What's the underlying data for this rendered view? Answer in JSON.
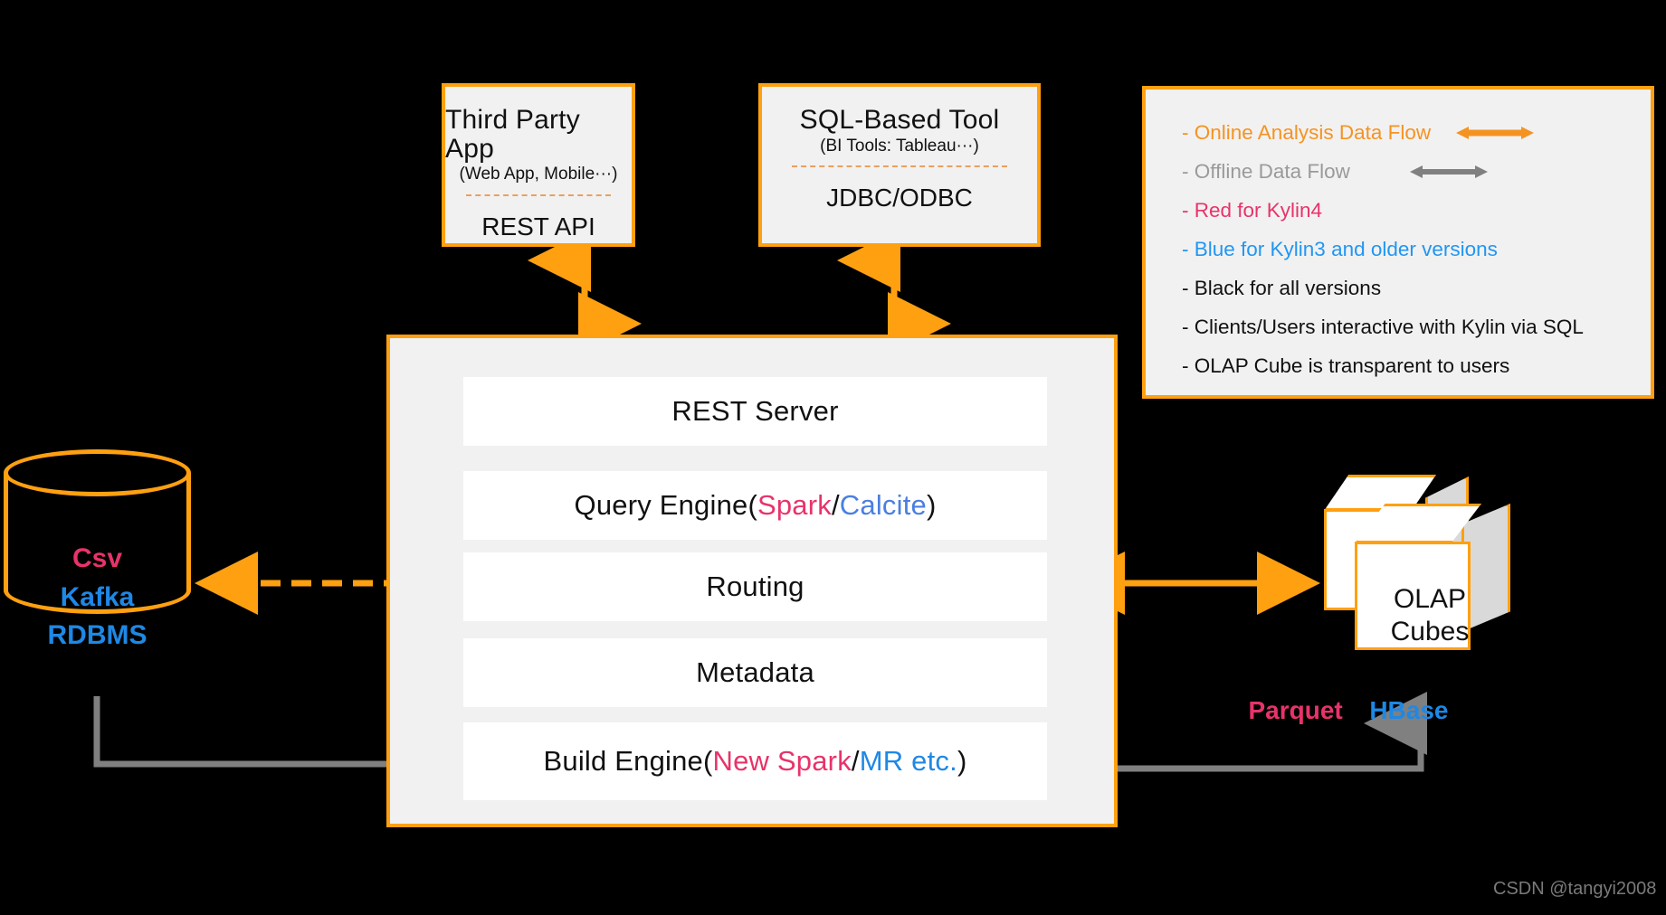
{
  "colors": {
    "orange": "#FFA010",
    "legend_orange": "#F59322",
    "gray": "#808080",
    "pink": "#E8336A",
    "blue": "#4A7FE0",
    "blue_bright": "#1E88E5",
    "box_fill": "#f1f1f1",
    "layer_fill": "#ffffff",
    "background": "#000000"
  },
  "clients": [
    {
      "id": "third-party-app",
      "title": "Third Party App",
      "subtitle": "(Web App, Mobile···)",
      "protocol": "REST API"
    },
    {
      "id": "sql-based-tool",
      "title": "SQL-Based Tool",
      "subtitle": "(BI Tools: Tableau···)",
      "protocol": "JDBC/ODBC"
    }
  ],
  "kylin": {
    "layers": [
      {
        "id": "rest-server",
        "text": "REST Server",
        "parts": [
          {
            "t": "REST Server",
            "c": "black"
          }
        ]
      },
      {
        "id": "query-engine",
        "text": "Query Engine(Spark/Calcite)",
        "parts": [
          {
            "t": "Query Engine(",
            "c": "black"
          },
          {
            "t": "Spark",
            "c": "pink"
          },
          {
            "t": "/",
            "c": "black"
          },
          {
            "t": "Calcite",
            "c": "blue"
          },
          {
            "t": ")",
            "c": "black"
          }
        ]
      },
      {
        "id": "routing",
        "text": "Routing",
        "parts": [
          {
            "t": "Routing",
            "c": "black"
          }
        ]
      },
      {
        "id": "metadata",
        "text": "Metadata",
        "parts": [
          {
            "t": "Metadata",
            "c": "black"
          }
        ]
      },
      {
        "id": "build-engine",
        "text": "Build Engine(New Spark/MR etc.)",
        "parts": [
          {
            "t": "Build Engine(",
            "c": "black"
          },
          {
            "t": "New Spark",
            "c": "pink"
          },
          {
            "t": "/",
            "c": "black"
          },
          {
            "t": "MR etc.",
            "c": "blue2"
          },
          {
            "t": ")",
            "c": "black"
          }
        ]
      }
    ]
  },
  "datasource": {
    "id": "data-source-cylinder",
    "items": [
      {
        "label": "Csv",
        "color": "pink"
      },
      {
        "label": "Kafka",
        "color": "blue_bright"
      },
      {
        "label": "RDBMS",
        "color": "blue_bright"
      }
    ]
  },
  "storage": {
    "id": "olap-cubes",
    "label_line1": "OLAP",
    "label_line2": "Cubes",
    "engines": [
      {
        "label": "Parquet",
        "color": "pink"
      },
      {
        "label": "HBase",
        "color": "blue_bright"
      }
    ]
  },
  "legend": {
    "rows": [
      {
        "text": "- Online Analysis Data Flow",
        "color": "orange",
        "arrow": "orange"
      },
      {
        "text": "- Offline Data Flow",
        "color": "gray",
        "arrow": "gray"
      },
      {
        "text": "- Red for Kylin4",
        "color": "pink",
        "arrow": null
      },
      {
        "text": "- Blue for Kylin3 and older versions",
        "color": "blue",
        "arrow": null
      },
      {
        "text": "- Black for all versions",
        "color": "black",
        "arrow": null
      },
      {
        "text": "- Clients/Users interactive with Kylin via SQL",
        "color": "black",
        "arrow": null
      },
      {
        "text": "- OLAP Cube is transparent to users",
        "color": "black",
        "arrow": null
      }
    ]
  },
  "watermark": {
    "text": "CSDN @tangyi2008"
  }
}
